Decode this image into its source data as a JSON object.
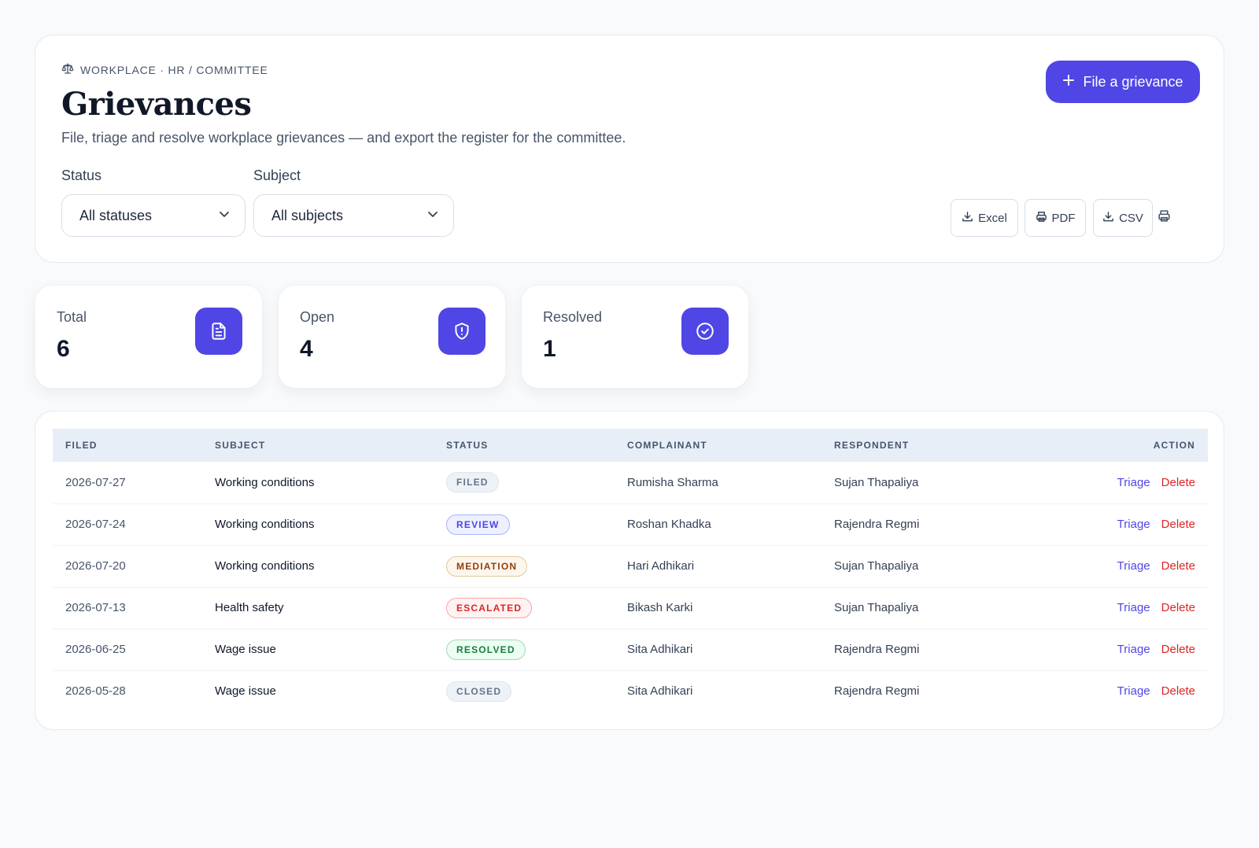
{
  "header": {
    "eyebrow": "WORKPLACE · HR / COMMITTEE",
    "eyebrow_icon": "scale-icon",
    "title": "Grievances",
    "subtitle": "File, triage and resolve workplace grievances — and export the register for the committee.",
    "primary_action": "File a grievance"
  },
  "filters": {
    "status_label": "Status",
    "status_value": "All statuses",
    "subject_label": "Subject",
    "subject_value": "All subjects"
  },
  "exports": {
    "excel": "Excel",
    "pdf": "PDF",
    "csv": "CSV"
  },
  "stats": [
    {
      "label": "Total",
      "value": "6",
      "icon": "document-icon"
    },
    {
      "label": "Open",
      "value": "4",
      "icon": "shield-alert-icon"
    },
    {
      "label": "Resolved",
      "value": "1",
      "icon": "check-circle-icon"
    }
  ],
  "table": {
    "columns": [
      "FILED",
      "SUBJECT",
      "STATUS",
      "COMPLAINANT",
      "RESPONDENT",
      "ACTION"
    ],
    "rows": [
      {
        "filed": "2026-07-27",
        "subject": "Working conditions",
        "status": "FILED",
        "complainant": "Rumisha Sharma",
        "respondent": "Sujan Thapaliya"
      },
      {
        "filed": "2026-07-24",
        "subject": "Working conditions",
        "status": "REVIEW",
        "complainant": "Roshan Khadka",
        "respondent": "Rajendra Regmi"
      },
      {
        "filed": "2026-07-20",
        "subject": "Working conditions",
        "status": "MEDIATION",
        "complainant": "Hari Adhikari",
        "respondent": "Sujan Thapaliya"
      },
      {
        "filed": "2026-07-13",
        "subject": "Health safety",
        "status": "ESCALATED",
        "complainant": "Bikash Karki",
        "respondent": "Sujan Thapaliya"
      },
      {
        "filed": "2026-06-25",
        "subject": "Wage issue",
        "status": "RESOLVED",
        "complainant": "Sita Adhikari",
        "respondent": "Rajendra Regmi"
      },
      {
        "filed": "2026-05-28",
        "subject": "Wage issue",
        "status": "CLOSED",
        "complainant": "Sita Adhikari",
        "respondent": "Rajendra Regmi"
      }
    ],
    "action_triage": "Triage",
    "action_delete": "Delete"
  },
  "colors": {
    "accent": "#4f46e5",
    "danger": "#dc2626",
    "badges": {
      "FILED": {
        "bg": "#eef2f7",
        "fg": "#64748b",
        "border": "#dfe5ee"
      },
      "REVIEW": {
        "bg": "#eef0ff",
        "fg": "#4f46e5",
        "border": "#a5b4fc"
      },
      "MEDIATION": {
        "bg": "#fdf6ec",
        "fg": "#92400e",
        "border": "#e2c9a3"
      },
      "ESCALATED": {
        "bg": "#fef2f2",
        "fg": "#dc2626",
        "border": "#fca5a5"
      },
      "RESOLVED": {
        "bg": "#ecfdf3",
        "fg": "#15803d",
        "border": "#a7d8b8"
      },
      "CLOSED": {
        "bg": "#eef2f7",
        "fg": "#64748b",
        "border": "#dfe5ee"
      }
    }
  }
}
